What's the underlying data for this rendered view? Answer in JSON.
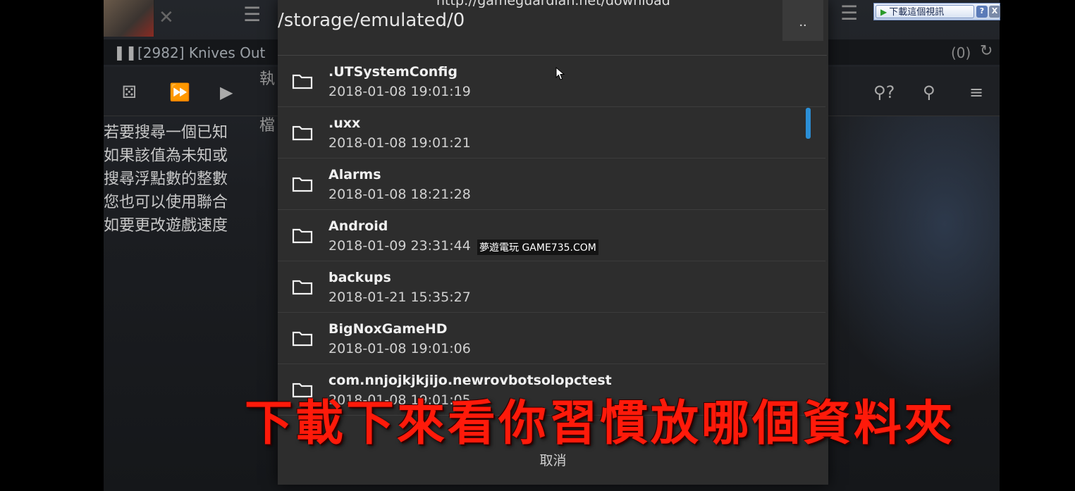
{
  "bg_app": {
    "process": "[2982] Knives Out",
    "count": "(0)",
    "help_lines": [
      "若要搜尋一個已知",
      "如果該值為未知或",
      "搜尋浮點數的整數",
      "您也可以使用聯合",
      "如要更改遊戲速度"
    ],
    "side_labels": [
      "執",
      "檔"
    ]
  },
  "dialog": {
    "url_hint": "http://gameguardian.net/download",
    "path": "/storage/emulated/0",
    "up_label": "..",
    "cancel_label": "取消",
    "folders": [
      {
        "name": ".UTSystemConfig",
        "date": "2018-01-08 19:01:19"
      },
      {
        "name": ".uxx",
        "date": "2018-01-08 19:01:21"
      },
      {
        "name": "Alarms",
        "date": "2018-01-08 18:21:28"
      },
      {
        "name": "Android",
        "date": "2018-01-09 23:31:44"
      },
      {
        "name": "backups",
        "date": "2018-01-21 15:35:27"
      },
      {
        "name": "BigNoxGameHD",
        "date": "2018-01-08 19:01:06"
      },
      {
        "name": "com.nnjojkjkjijo.newrovbotsolopctest",
        "date": "2018-01-08 19:01:05"
      }
    ]
  },
  "watermark": "夢遊電玩 GAME735.COM",
  "subtitle": "下載下來看你習慣放哪個資料夾",
  "download_badge": {
    "label": "下載這個視訊",
    "help": "?",
    "close": "X"
  },
  "colors": {
    "subtitle": "#ff1a0a",
    "scroll_accent": "#2b8fd6",
    "dialog_bg": "#2d2d2d"
  }
}
